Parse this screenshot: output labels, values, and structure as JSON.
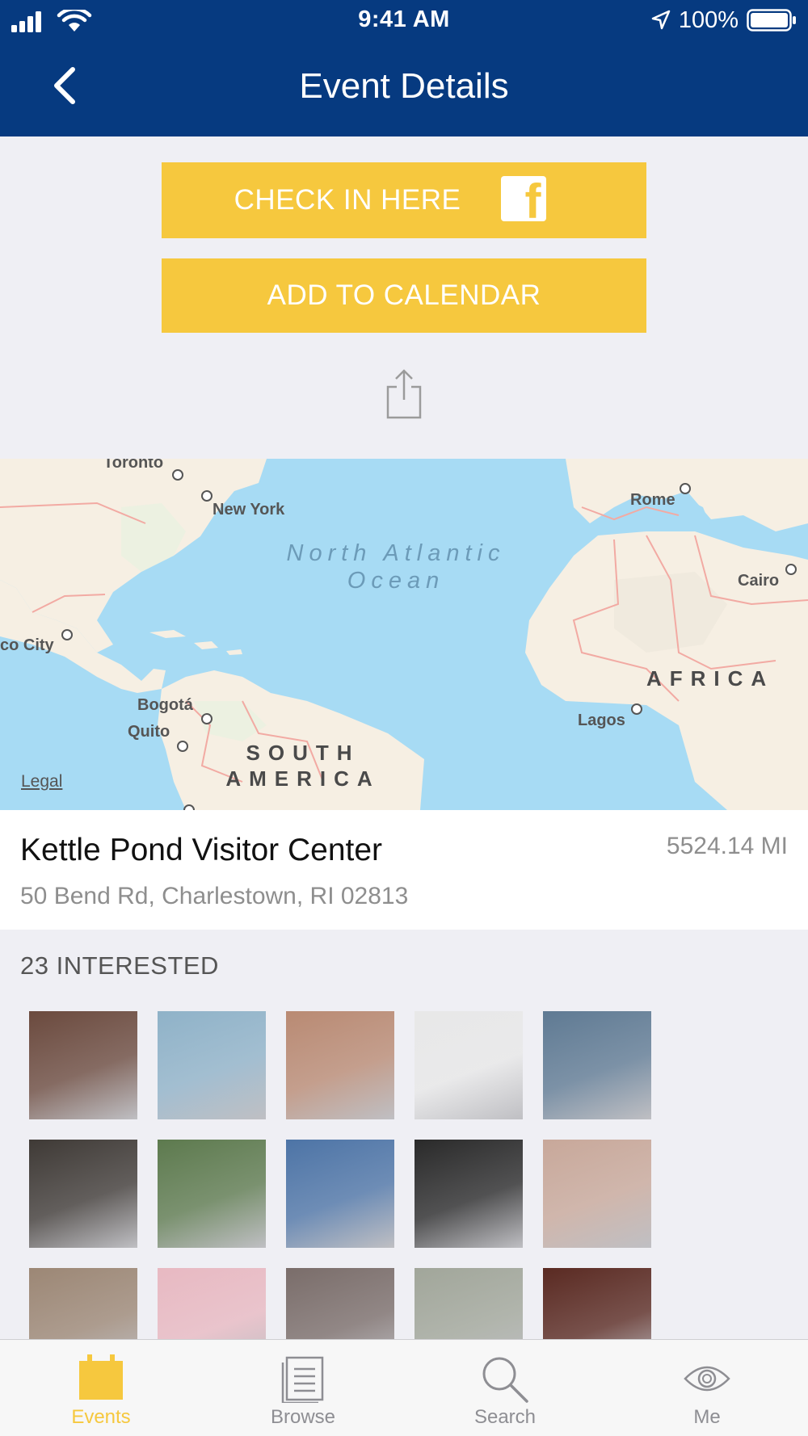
{
  "status_bar": {
    "time": "9:41 AM",
    "battery": "100%"
  },
  "nav": {
    "title": "Event Details"
  },
  "actions": {
    "check_in_label": "CHECK IN HERE",
    "calendar_label": "ADD TO CALENDAR"
  },
  "map": {
    "places": [
      "Toronto",
      "New York",
      "Rome",
      "Cairo",
      "co City",
      "Bogotá",
      "Quito",
      "Lagos"
    ],
    "ocean_line1": "North Atlantic",
    "ocean_line2": "Ocean",
    "region_south_america_1": "SOUTH",
    "region_south_america_2": "AMERICA",
    "region_africa": "AFRICA",
    "legal": "Legal"
  },
  "location": {
    "name": "Kettle Pond Visitor Center",
    "address": "50 Bend Rd, Charlestown, RI 02813",
    "distance": "5524.14 MI"
  },
  "interested": {
    "title": "23 INTERESTED",
    "avatar_colors": [
      "#6b4a3e",
      "#8fb2c8",
      "#b98a73",
      "#e8e8e8",
      "#5f7a93",
      "#3f3a36",
      "#5d7a4e",
      "#4d74a6",
      "#2a2a2a",
      "#c8a89a",
      "#9c8775",
      "#e8b9c2",
      "#7a6d6a",
      "#a1a69a",
      "#5a2a22"
    ]
  },
  "colors": {
    "nav_bg": "#063a80",
    "accent": "#f6c83e"
  },
  "tabs": [
    {
      "label": "Events",
      "icon": "calendar-icon",
      "active": true
    },
    {
      "label": "Browse",
      "icon": "list-icon",
      "active": false
    },
    {
      "label": "Search",
      "icon": "search-icon",
      "active": false
    },
    {
      "label": "Me",
      "icon": "eye-icon",
      "active": false
    }
  ]
}
